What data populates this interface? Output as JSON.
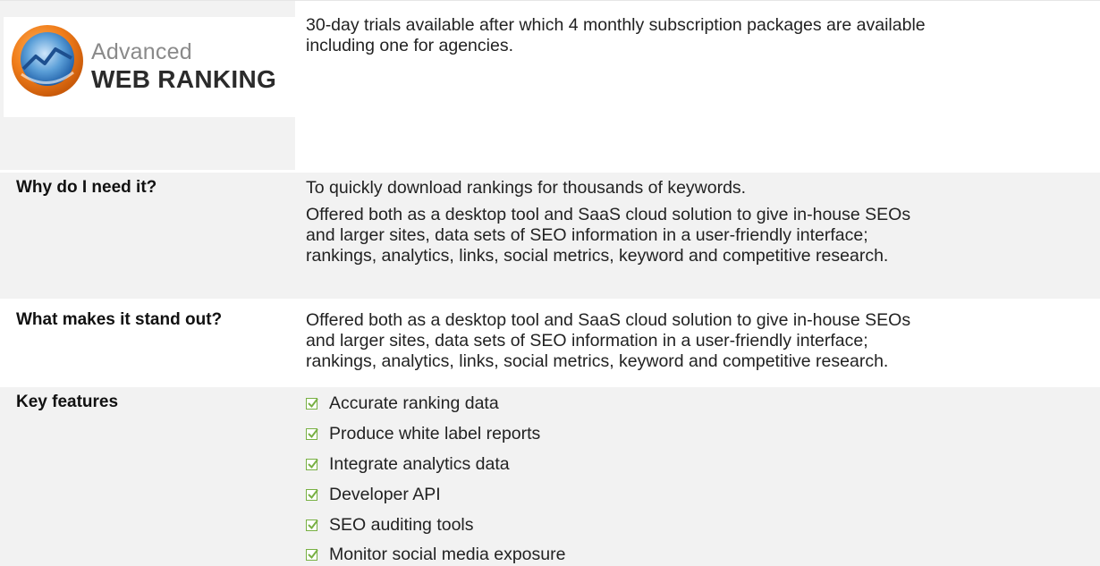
{
  "logo": {
    "name_small": "Advanced",
    "name_big": "WEB RANKING"
  },
  "intro": {
    "line1": "30-day trials available after which 4 monthly subscription packages are available",
    "line2": "including one for agencies."
  },
  "why": {
    "label": "Why do I need it?",
    "line1": "To quickly download rankings for thousands of keywords.",
    "p2_line1": "Offered both as a desktop tool and SaaS cloud solution to give in-house SEOs",
    "p2_line2": "and larger sites, data sets of SEO information in a user-friendly interface;",
    "p2_line3": "rankings, analytics, links, social metrics, keyword and competitive research."
  },
  "standout": {
    "label": "What makes it stand out?",
    "line1": "Offered both as a desktop tool and SaaS cloud solution to give in-house SEOs",
    "line2": "and larger sites, data sets of SEO information in a user-friendly interface;",
    "line3": "rankings, analytics, links, social metrics, keyword and competitive research."
  },
  "features": {
    "label": "Key features",
    "items": [
      "Accurate ranking data",
      "Produce white label reports",
      "Integrate analytics data",
      "Developer API",
      "SEO auditing tools",
      "Monitor social media exposure"
    ]
  },
  "colors": {
    "shade": "#f2f2f2",
    "check": "#78b043"
  }
}
